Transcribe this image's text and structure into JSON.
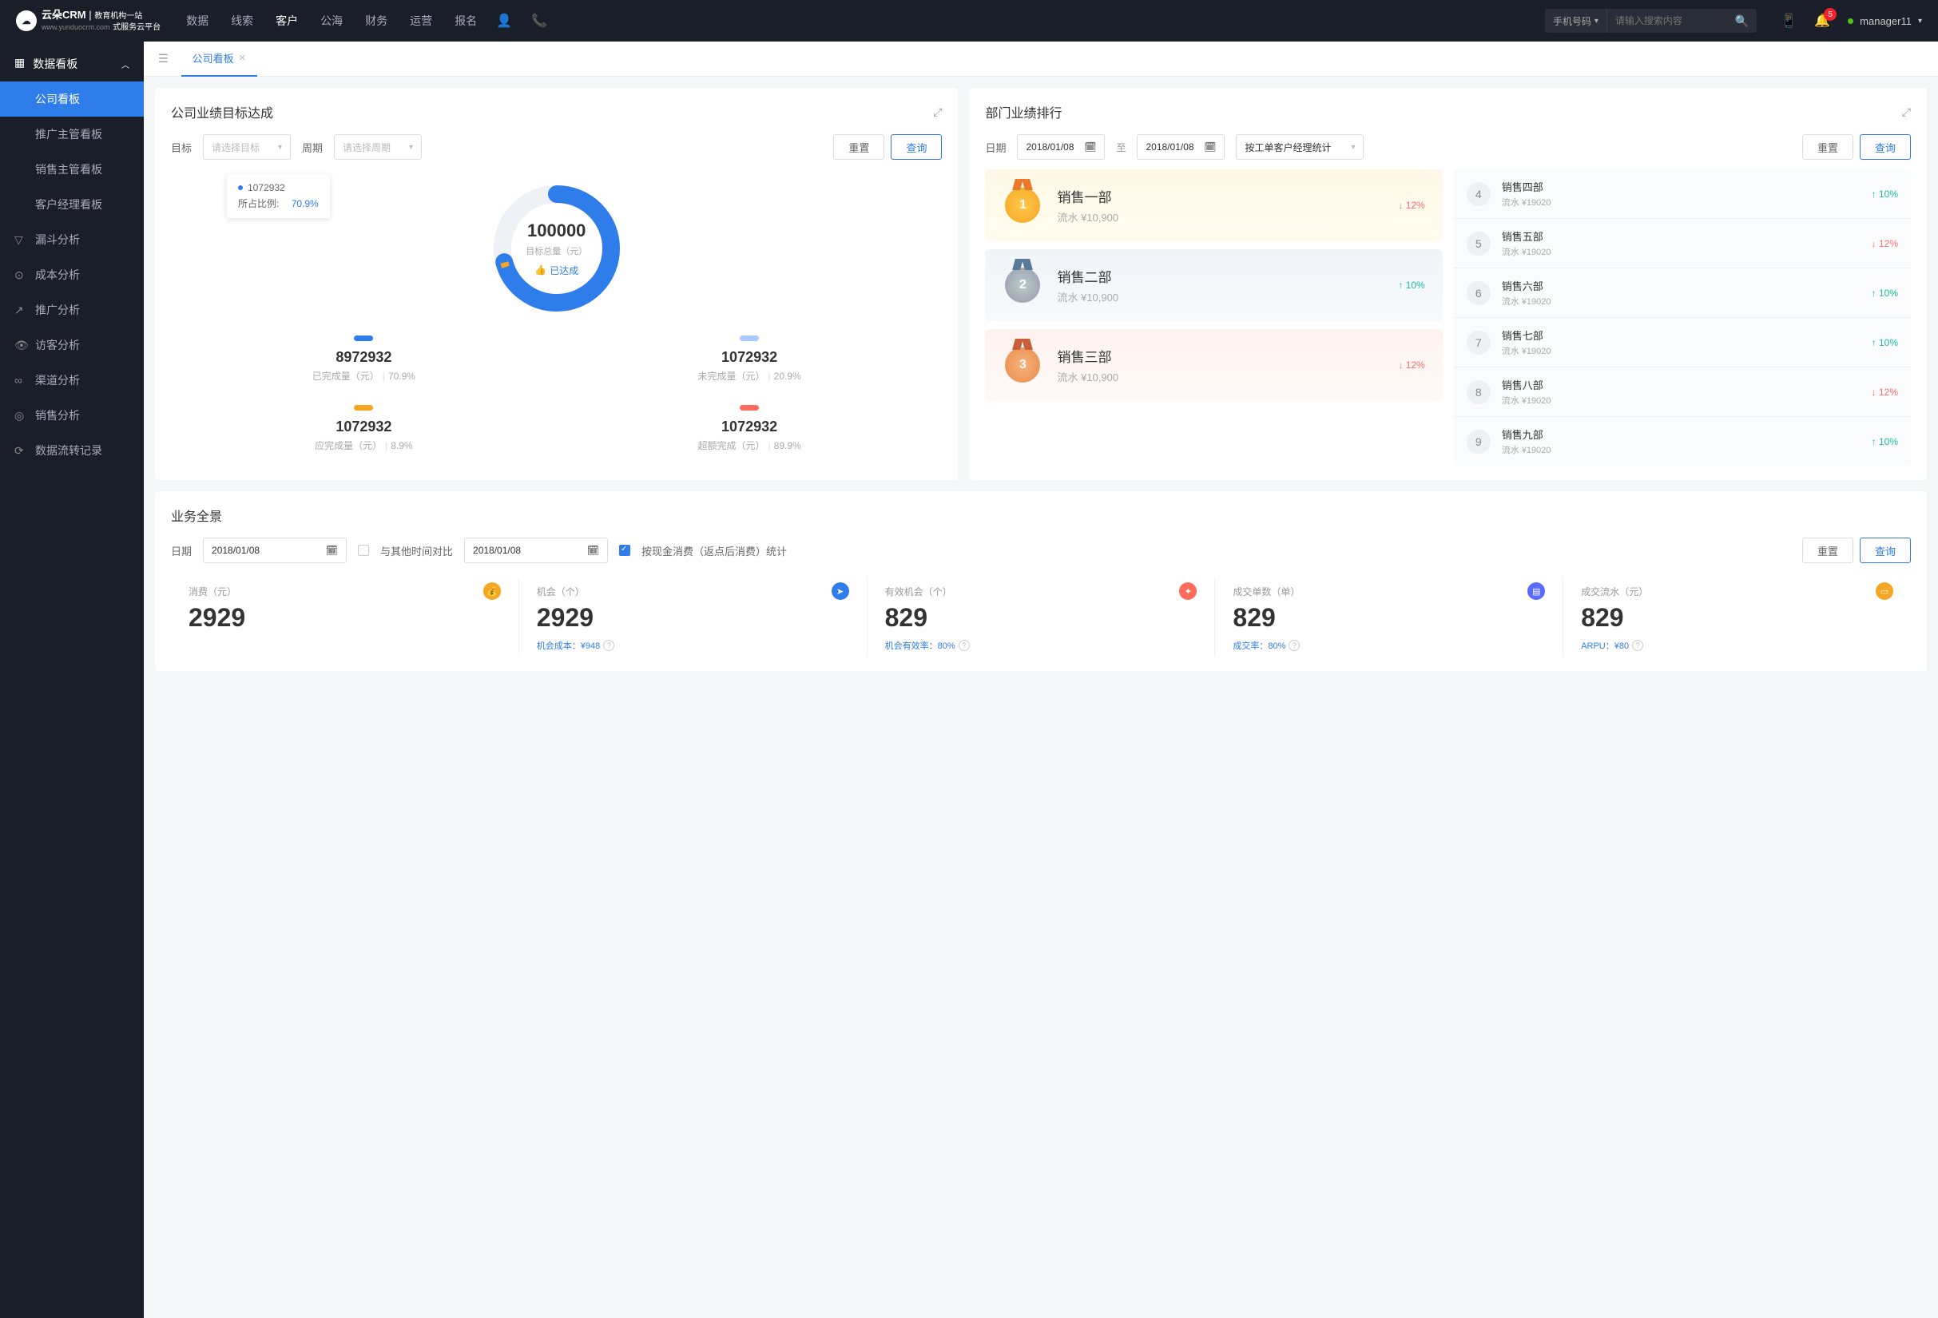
{
  "brand": {
    "name": "云朵CRM",
    "sub1": "教育机构一站",
    "sub2": "式服务云平台",
    "domain": "www.yunduocrm.com"
  },
  "nav": [
    "数据",
    "线索",
    "客户",
    "公海",
    "财务",
    "运营",
    "报名"
  ],
  "nav_active": 2,
  "search": {
    "type": "手机号码",
    "placeholder": "请输入搜索内容"
  },
  "notif": "5",
  "username": "manager11",
  "sidebar": {
    "head": "数据看板",
    "subs": [
      "公司看板",
      "推广主管看板",
      "销售主管看板",
      "客户经理看板"
    ],
    "items": [
      {
        "label": "漏斗分析"
      },
      {
        "label": "成本分析"
      },
      {
        "label": "推广分析"
      },
      {
        "label": "访客分析"
      },
      {
        "label": "渠道分析"
      },
      {
        "label": "销售分析"
      },
      {
        "label": "数据流转记录"
      }
    ]
  },
  "tab": "公司看板",
  "target": {
    "title": "公司业绩目标达成",
    "lbl_goal": "目标",
    "ph_goal": "请选择目标",
    "lbl_period": "周期",
    "ph_period": "请选择周期",
    "btn_reset": "重置",
    "btn_query": "查询",
    "tooltip_val": "1072932",
    "tooltip_lbl": "所占比例:",
    "tooltip_pct": "70.9%",
    "center_val": "100000",
    "center_lbl": "目标总量（元）",
    "reached": "已达成",
    "cells": [
      {
        "color": "#2f7deb",
        "value": "8972932",
        "label": "已完成量（元）",
        "pct": "70.9%"
      },
      {
        "color": "#a8caff",
        "value": "1072932",
        "label": "未完成量（元）",
        "pct": "20.9%"
      },
      {
        "color": "#f5a623",
        "value": "1072932",
        "label": "应完成量（元）",
        "pct": "8.9%"
      },
      {
        "color": "#ff6b5c",
        "value": "1072932",
        "label": "超额完成（元）",
        "pct": "89.9%"
      }
    ]
  },
  "rank": {
    "title": "部门业绩排行",
    "lbl_date": "日期",
    "date_from": "2018/01/08",
    "to": "至",
    "date_to": "2018/01/08",
    "group_by": "按工单客户经理统计",
    "btn_reset": "重置",
    "btn_query": "查询",
    "top": [
      {
        "num": "1",
        "name": "销售一部",
        "val": "流水 ¥10,900",
        "pct": "12%",
        "dir": "down",
        "cls": "gold"
      },
      {
        "num": "2",
        "name": "销售二部",
        "val": "流水 ¥10,900",
        "pct": "10%",
        "dir": "up",
        "cls": "silver"
      },
      {
        "num": "3",
        "name": "销售三部",
        "val": "流水 ¥10,900",
        "pct": "12%",
        "dir": "down",
        "cls": "bronze"
      }
    ],
    "rest": [
      {
        "rank": "4",
        "name": "销售四部",
        "val": "流水 ¥19020",
        "pct": "10%",
        "dir": "up"
      },
      {
        "rank": "5",
        "name": "销售五部",
        "val": "流水 ¥19020",
        "pct": "12%",
        "dir": "down"
      },
      {
        "rank": "6",
        "name": "销售六部",
        "val": "流水 ¥19020",
        "pct": "10%",
        "dir": "up"
      },
      {
        "rank": "7",
        "name": "销售七部",
        "val": "流水 ¥19020",
        "pct": "10%",
        "dir": "up"
      },
      {
        "rank": "8",
        "name": "销售八部",
        "val": "流水 ¥19020",
        "pct": "12%",
        "dir": "down"
      },
      {
        "rank": "9",
        "name": "销售九部",
        "val": "流水 ¥19020",
        "pct": "10%",
        "dir": "up"
      }
    ]
  },
  "biz": {
    "title": "业务全景",
    "lbl_date": "日期",
    "date": "2018/01/08",
    "compare": "与其他时间对比",
    "date2": "2018/01/08",
    "checkbox": "按现金消费（返点后消费）统计",
    "btn_reset": "重置",
    "btn_query": "查询",
    "kpis": [
      {
        "label": "消费（元）",
        "value": "2929",
        "sub": "",
        "color": "#f5a623",
        "glyph": "💰"
      },
      {
        "label": "机会（个）",
        "value": "2929",
        "sub": "机会成本：¥948",
        "color": "#2f7deb",
        "glyph": "➤"
      },
      {
        "label": "有效机会（个）",
        "value": "829",
        "sub": "机会有效率：80%",
        "color": "#ff6b5c",
        "glyph": "✦"
      },
      {
        "label": "成交单数（单）",
        "value": "829",
        "sub": "成交率：80%",
        "color": "#5a6bff",
        "glyph": "▤"
      },
      {
        "label": "成交流水（元）",
        "value": "829",
        "sub": "ARPU：¥80",
        "color": "#f5a623",
        "glyph": "▭"
      }
    ]
  },
  "chart_data": {
    "type": "pie",
    "title": "目标总量（元）100000",
    "series": [
      {
        "name": "已完成量",
        "value": 8972932,
        "pct": 70.9,
        "color": "#2f7deb"
      },
      {
        "name": "未完成量",
        "value": 1072932,
        "pct": 20.9,
        "color": "#a8caff"
      },
      {
        "name": "应完成量",
        "value": 1072932,
        "pct": 8.9,
        "color": "#f5a623"
      },
      {
        "name": "超额完成",
        "value": 1072932,
        "pct": 89.9,
        "color": "#ff6b5c"
      }
    ]
  }
}
